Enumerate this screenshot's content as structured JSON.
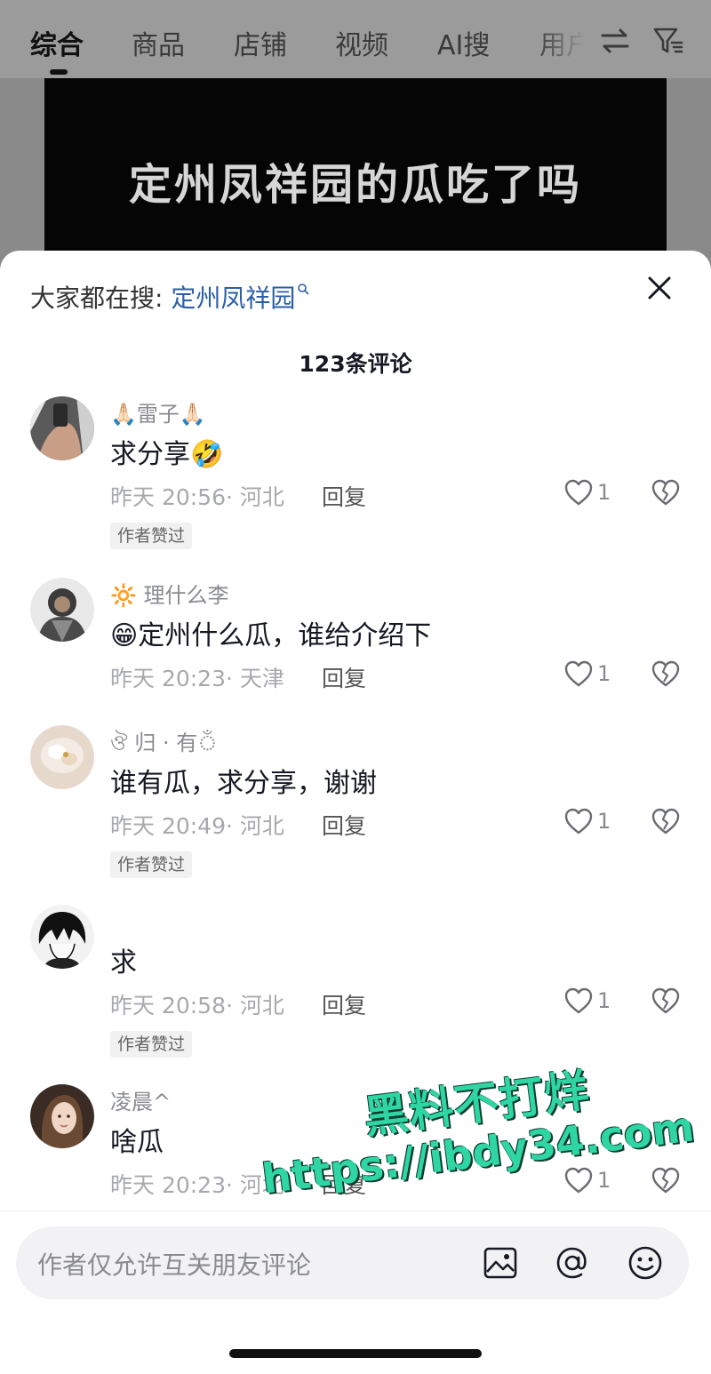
{
  "tabs": [
    {
      "label": "综合",
      "active": true
    },
    {
      "label": "商品"
    },
    {
      "label": "店铺"
    },
    {
      "label": "视频"
    },
    {
      "label": "AI搜"
    },
    {
      "label": "用户"
    }
  ],
  "top_icons": [
    "swap-icon",
    "filter-icon"
  ],
  "video": {
    "caption": "定州凤祥园的瓜吃了吗"
  },
  "sheet": {
    "search_prefix": "大家都在搜: ",
    "search_term": "定州凤祥园",
    "comment_count": "123条评论"
  },
  "comments": [
    {
      "nickname": "🙏🏻雷子🙏🏻",
      "text": "求分享🤣",
      "time": "昨天 20:56",
      "location": "河北",
      "reply": "回复",
      "likes": "1",
      "badge": "作者赞过"
    },
    {
      "nickname": "🔆 理什么李",
      "text": "😁定州什么瓜，谁给介绍下",
      "time": "昨天 20:23",
      "location": "天津",
      "reply": "回复",
      "likes": "1",
      "badge": ""
    },
    {
      "nickname": "ঔ 归 · 有ঁ",
      "text": "谁有瓜，求分享，谢谢",
      "time": "昨天 20:49",
      "location": "河北",
      "reply": "回复",
      "likes": "1",
      "badge": "作者赞过"
    },
    {
      "nickname": "",
      "text": "求",
      "time": "昨天 20:58",
      "location": "河北",
      "reply": "回复",
      "likes": "1",
      "badge": "作者赞过"
    },
    {
      "nickname": "凌晨^",
      "text": "啥瓜",
      "time": "昨天 20:23",
      "location": "河北",
      "reply": "回复",
      "likes": "1",
      "badge": ""
    }
  ],
  "input": {
    "placeholder": "作者仅允许互关朋友评论"
  },
  "input_icons": [
    "image-icon",
    "mention-icon",
    "emoji-icon"
  ],
  "watermark": {
    "line1": "黑料不打烊",
    "line2": "https://ibdy34.com"
  },
  "colors": {
    "accent_link": "#2a5ea8",
    "watermark": "#2fd6a4"
  }
}
